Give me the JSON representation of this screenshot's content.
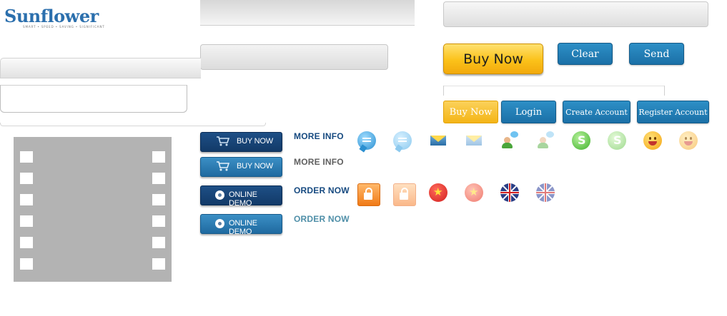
{
  "logo": {
    "name": "Sunflower",
    "tagline": "SMART • SPEED • SAVING • SIGNIFICANT"
  },
  "buttons": {
    "buy_now_large": "Buy Now",
    "clear": "Clear",
    "send": "Send",
    "buy_now_small": "Buy Now",
    "login": "Login",
    "create_account": "Create Account",
    "register_account": "Register Account"
  },
  "action_buttons": [
    {
      "label": "BUY NOW",
      "style": "dark",
      "icon": "cart-icon"
    },
    {
      "label": "BUY NOW",
      "style": "light",
      "icon": "cart-icon"
    },
    {
      "label": "ONLINE DEMO",
      "style": "dark",
      "icon": "disc-icon"
    },
    {
      "label": "ONLINE DEMO",
      "style": "light",
      "icon": "disc-icon"
    }
  ],
  "links": [
    "MORE INFO",
    "MORE INFO",
    "ORDER NOW",
    "ORDER NOW"
  ],
  "icons": {
    "row1": [
      "chat-icon",
      "chat-icon-faded",
      "mail-icon",
      "mail-icon-faded",
      "contact-icon",
      "contact-icon-faded",
      "skype-icon",
      "skype-icon-faded",
      "smiley-icon",
      "smiley-icon-faded"
    ],
    "row2": [
      "lock-icon",
      "lock-icon-faded",
      "vietnam-flag-icon",
      "vietnam-flag-icon-faded",
      "uk-flag-icon",
      "uk-flag-icon-faded"
    ]
  },
  "colors": {
    "brand_blue": "#1b70a7",
    "navy": "#123a68",
    "gold": "#fbc21a",
    "placeholder_gray": "#b3b3b3"
  }
}
